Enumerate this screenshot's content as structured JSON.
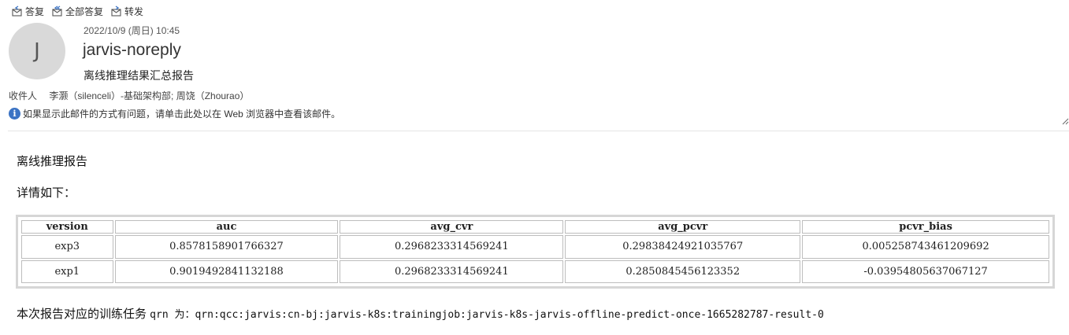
{
  "toolbar": {
    "reply": {
      "label": "答复",
      "icon": "reply-icon"
    },
    "reply_all": {
      "label": "全部答复",
      "icon": "reply-all-icon"
    },
    "forward": {
      "label": "转发",
      "icon": "forward-icon"
    }
  },
  "message": {
    "avatar_initial": "J",
    "date": "2022/10/9 (周日) 10:45",
    "sender": "jarvis-noreply",
    "subject": "离线推理结果汇总报告",
    "recipients_label": "收件人",
    "recipients": "李灏（silenceli）-基础架构部; 周饶（Zhourao）",
    "info_text": "如果显示此邮件的方式有问题，请单击此处以在 Web 浏览器中查看该邮件。"
  },
  "content": {
    "title": "离线推理报告",
    "detail": "详情如下：",
    "table": {
      "headers": [
        "version",
        "auc",
        "avg_cvr",
        "avg_pcvr",
        "pcvr_bias"
      ],
      "rows": [
        [
          "exp3",
          "0.8578158901766327",
          "0.2968233314569241",
          "0.29838424921035767",
          "0.005258743461209692"
        ],
        [
          "exp1",
          "0.9019492841132188",
          "0.2968233314569241",
          "0.2850845456123352",
          "-0.03954805637067127"
        ]
      ]
    },
    "footer_prefix": "本次报告对应的训练任务 ",
    "footer_code": "qrn 为：qrn:qcc:jarvis:cn-bj:jarvis-k8s:trainingjob:jarvis-k8s-jarvis-offline-predict-once-1665282787-result-0"
  },
  "colors": {
    "info_icon": "#3b73c4",
    "avatar_bg": "#d9d9d9"
  }
}
